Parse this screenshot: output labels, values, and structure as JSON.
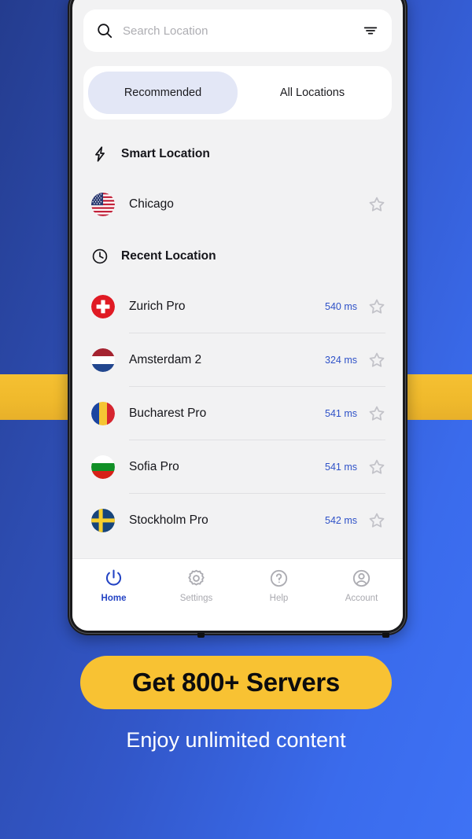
{
  "search": {
    "placeholder": "Search Location",
    "value": "",
    "search_icon": "search-icon",
    "filter_icon": "filter-icon"
  },
  "tabs": [
    {
      "label": "Recommended",
      "active": true
    },
    {
      "label": "All Locations",
      "active": false
    }
  ],
  "sections": {
    "smart": {
      "label": "Smart Location",
      "icon": "lightning-bolt-icon"
    },
    "recent": {
      "label": "Recent Location",
      "icon": "clock-icon"
    }
  },
  "smart_location": {
    "name": "Chicago",
    "flag": "us-flag",
    "ping": "",
    "starred": false
  },
  "recent_locations": [
    {
      "name": "Zurich Pro",
      "flag": "ch-flag",
      "ping": "540 ms",
      "starred": false
    },
    {
      "name": "Amsterdam 2",
      "flag": "nl-flag",
      "ping": "324 ms",
      "starred": false
    },
    {
      "name": "Bucharest Pro",
      "flag": "ro-flag",
      "ping": "541 ms",
      "starred": false
    },
    {
      "name": "Sofia Pro",
      "flag": "bg-flag",
      "ping": "541 ms",
      "starred": false
    },
    {
      "name": "Stockholm Pro",
      "flag": "se-flag",
      "ping": "542 ms",
      "starred": false
    }
  ],
  "bottom_nav": [
    {
      "label": "Home",
      "icon": "power-icon",
      "active": true
    },
    {
      "label": "Settings",
      "icon": "gear-icon",
      "active": false
    },
    {
      "label": "Help",
      "icon": "question-icon",
      "active": false
    },
    {
      "label": "Account",
      "icon": "person-icon",
      "active": false
    }
  ],
  "promo": {
    "button_label": "Get 800+ Servers",
    "subtitle": "Enjoy unlimited content"
  },
  "colors": {
    "accent_blue": "#2343c4",
    "ping_blue": "#2f52c8",
    "promo_yellow": "#f8c233",
    "tab_active_bg": "#e3e7f6",
    "screen_bg": "#f2f2f3",
    "bg_gradient_start": "#243c8e",
    "bg_gradient_end": "#3e72f5",
    "stripe_yellow": "#f0ba2c"
  }
}
